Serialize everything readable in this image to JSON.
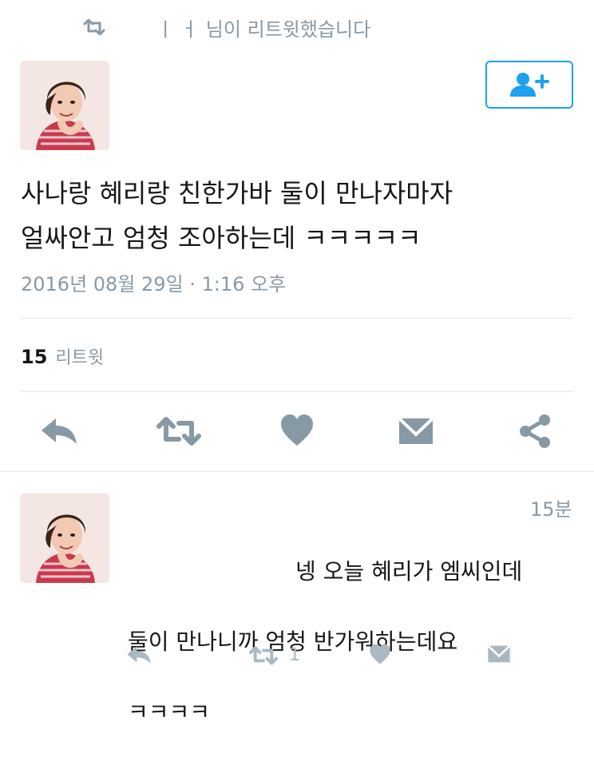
{
  "retweet_context": {
    "name": "ㅣ ㅓ",
    "text": "님이 리트윗했습니다"
  },
  "tweet": {
    "text": "사나랑 혜리랑 친한가바 둘이 만나자마자\n얼싸안고 엄청 조아하는데 ㅋㅋㅋㅋㅋ",
    "timestamp": "2016년 08월 29일 · 1:16 오후",
    "retweet_count": "15",
    "retweet_label": "리트윗"
  },
  "icons": {
    "retweet_context": "retweet-icon",
    "follow": "add-user-icon",
    "reply": "reply-icon",
    "retweet": "retweet-icon",
    "like": "heart-icon",
    "message": "envelope-icon",
    "share": "share-icon"
  },
  "reply": {
    "time": "15분",
    "text_line1": "넹 오늘 혜리가 엠씨인데",
    "text_line2": "둘이 만나니까 엄청 반가워하는데요",
    "text_line3": "ㅋㅋㅋㅋ",
    "retweet_count": "1"
  },
  "colors": {
    "accent": "#1da1f2",
    "action_icon": "#8899a6",
    "muted_text": "#8899a6",
    "divider": "#e1e8ed"
  }
}
